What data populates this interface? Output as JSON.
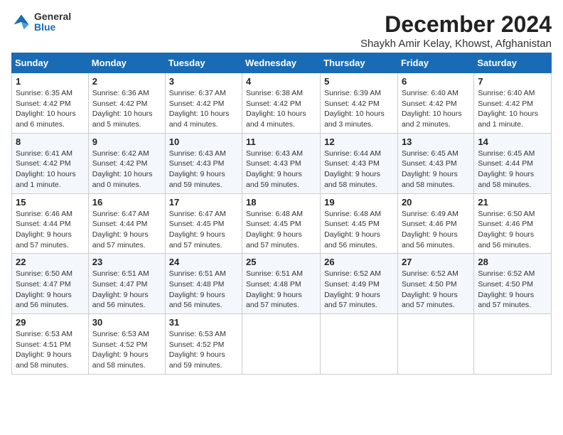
{
  "header": {
    "logo_line1": "General",
    "logo_line2": "Blue",
    "title": "December 2024",
    "subtitle": "Shaykh Amir Kelay, Khowst, Afghanistan"
  },
  "weekdays": [
    "Sunday",
    "Monday",
    "Tuesday",
    "Wednesday",
    "Thursday",
    "Friday",
    "Saturday"
  ],
  "weeks": [
    [
      {
        "day": 1,
        "sunrise": "6:35 AM",
        "sunset": "4:42 PM",
        "daylight": "10 hours and 6 minutes."
      },
      {
        "day": 2,
        "sunrise": "6:36 AM",
        "sunset": "4:42 PM",
        "daylight": "10 hours and 5 minutes."
      },
      {
        "day": 3,
        "sunrise": "6:37 AM",
        "sunset": "4:42 PM",
        "daylight": "10 hours and 4 minutes."
      },
      {
        "day": 4,
        "sunrise": "6:38 AM",
        "sunset": "4:42 PM",
        "daylight": "10 hours and 4 minutes."
      },
      {
        "day": 5,
        "sunrise": "6:39 AM",
        "sunset": "4:42 PM",
        "daylight": "10 hours and 3 minutes."
      },
      {
        "day": 6,
        "sunrise": "6:40 AM",
        "sunset": "4:42 PM",
        "daylight": "10 hours and 2 minutes."
      },
      {
        "day": 7,
        "sunrise": "6:40 AM",
        "sunset": "4:42 PM",
        "daylight": "10 hours and 1 minute."
      }
    ],
    [
      {
        "day": 8,
        "sunrise": "6:41 AM",
        "sunset": "4:42 PM",
        "daylight": "10 hours and 1 minute."
      },
      {
        "day": 9,
        "sunrise": "6:42 AM",
        "sunset": "4:42 PM",
        "daylight": "10 hours and 0 minutes."
      },
      {
        "day": 10,
        "sunrise": "6:43 AM",
        "sunset": "4:43 PM",
        "daylight": "9 hours and 59 minutes."
      },
      {
        "day": 11,
        "sunrise": "6:43 AM",
        "sunset": "4:43 PM",
        "daylight": "9 hours and 59 minutes."
      },
      {
        "day": 12,
        "sunrise": "6:44 AM",
        "sunset": "4:43 PM",
        "daylight": "9 hours and 58 minutes."
      },
      {
        "day": 13,
        "sunrise": "6:45 AM",
        "sunset": "4:43 PM",
        "daylight": "9 hours and 58 minutes."
      },
      {
        "day": 14,
        "sunrise": "6:45 AM",
        "sunset": "4:44 PM",
        "daylight": "9 hours and 58 minutes."
      }
    ],
    [
      {
        "day": 15,
        "sunrise": "6:46 AM",
        "sunset": "4:44 PM",
        "daylight": "9 hours and 57 minutes."
      },
      {
        "day": 16,
        "sunrise": "6:47 AM",
        "sunset": "4:44 PM",
        "daylight": "9 hours and 57 minutes."
      },
      {
        "day": 17,
        "sunrise": "6:47 AM",
        "sunset": "4:45 PM",
        "daylight": "9 hours and 57 minutes."
      },
      {
        "day": 18,
        "sunrise": "6:48 AM",
        "sunset": "4:45 PM",
        "daylight": "9 hours and 57 minutes."
      },
      {
        "day": 19,
        "sunrise": "6:48 AM",
        "sunset": "4:45 PM",
        "daylight": "9 hours and 56 minutes."
      },
      {
        "day": 20,
        "sunrise": "6:49 AM",
        "sunset": "4:46 PM",
        "daylight": "9 hours and 56 minutes."
      },
      {
        "day": 21,
        "sunrise": "6:50 AM",
        "sunset": "4:46 PM",
        "daylight": "9 hours and 56 minutes."
      }
    ],
    [
      {
        "day": 22,
        "sunrise": "6:50 AM",
        "sunset": "4:47 PM",
        "daylight": "9 hours and 56 minutes."
      },
      {
        "day": 23,
        "sunrise": "6:51 AM",
        "sunset": "4:47 PM",
        "daylight": "9 hours and 56 minutes."
      },
      {
        "day": 24,
        "sunrise": "6:51 AM",
        "sunset": "4:48 PM",
        "daylight": "9 hours and 56 minutes."
      },
      {
        "day": 25,
        "sunrise": "6:51 AM",
        "sunset": "4:48 PM",
        "daylight": "9 hours and 57 minutes."
      },
      {
        "day": 26,
        "sunrise": "6:52 AM",
        "sunset": "4:49 PM",
        "daylight": "9 hours and 57 minutes."
      },
      {
        "day": 27,
        "sunrise": "6:52 AM",
        "sunset": "4:50 PM",
        "daylight": "9 hours and 57 minutes."
      },
      {
        "day": 28,
        "sunrise": "6:52 AM",
        "sunset": "4:50 PM",
        "daylight": "9 hours and 57 minutes."
      }
    ],
    [
      {
        "day": 29,
        "sunrise": "6:53 AM",
        "sunset": "4:51 PM",
        "daylight": "9 hours and 58 minutes."
      },
      {
        "day": 30,
        "sunrise": "6:53 AM",
        "sunset": "4:52 PM",
        "daylight": "9 hours and 58 minutes."
      },
      {
        "day": 31,
        "sunrise": "6:53 AM",
        "sunset": "4:52 PM",
        "daylight": "9 hours and 59 minutes."
      },
      null,
      null,
      null,
      null
    ]
  ]
}
